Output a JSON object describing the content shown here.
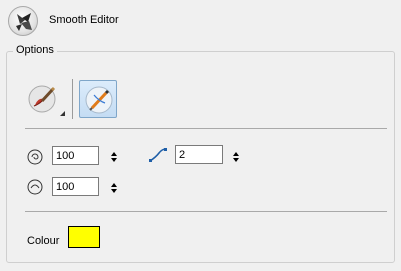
{
  "header": {
    "title": "Smooth Editor",
    "icon": "smooth-editor-tool-icon"
  },
  "options": {
    "label": "Options",
    "modes": [
      {
        "name": "brush-contour-mode",
        "icon": "brush-pencil-icon",
        "selected": false
      },
      {
        "name": "smooth-mode",
        "icon": "pencil-smooth-icon",
        "selected": true
      }
    ],
    "smoothness": {
      "icon": "spiral-icon",
      "value": "100"
    },
    "contour_points": {
      "icon": "curve-points-icon",
      "value": "2"
    },
    "radius": {
      "icon": "circle-radius-icon",
      "value": "100"
    },
    "colour": {
      "label": "Colour",
      "value": "#ffff00"
    }
  }
}
